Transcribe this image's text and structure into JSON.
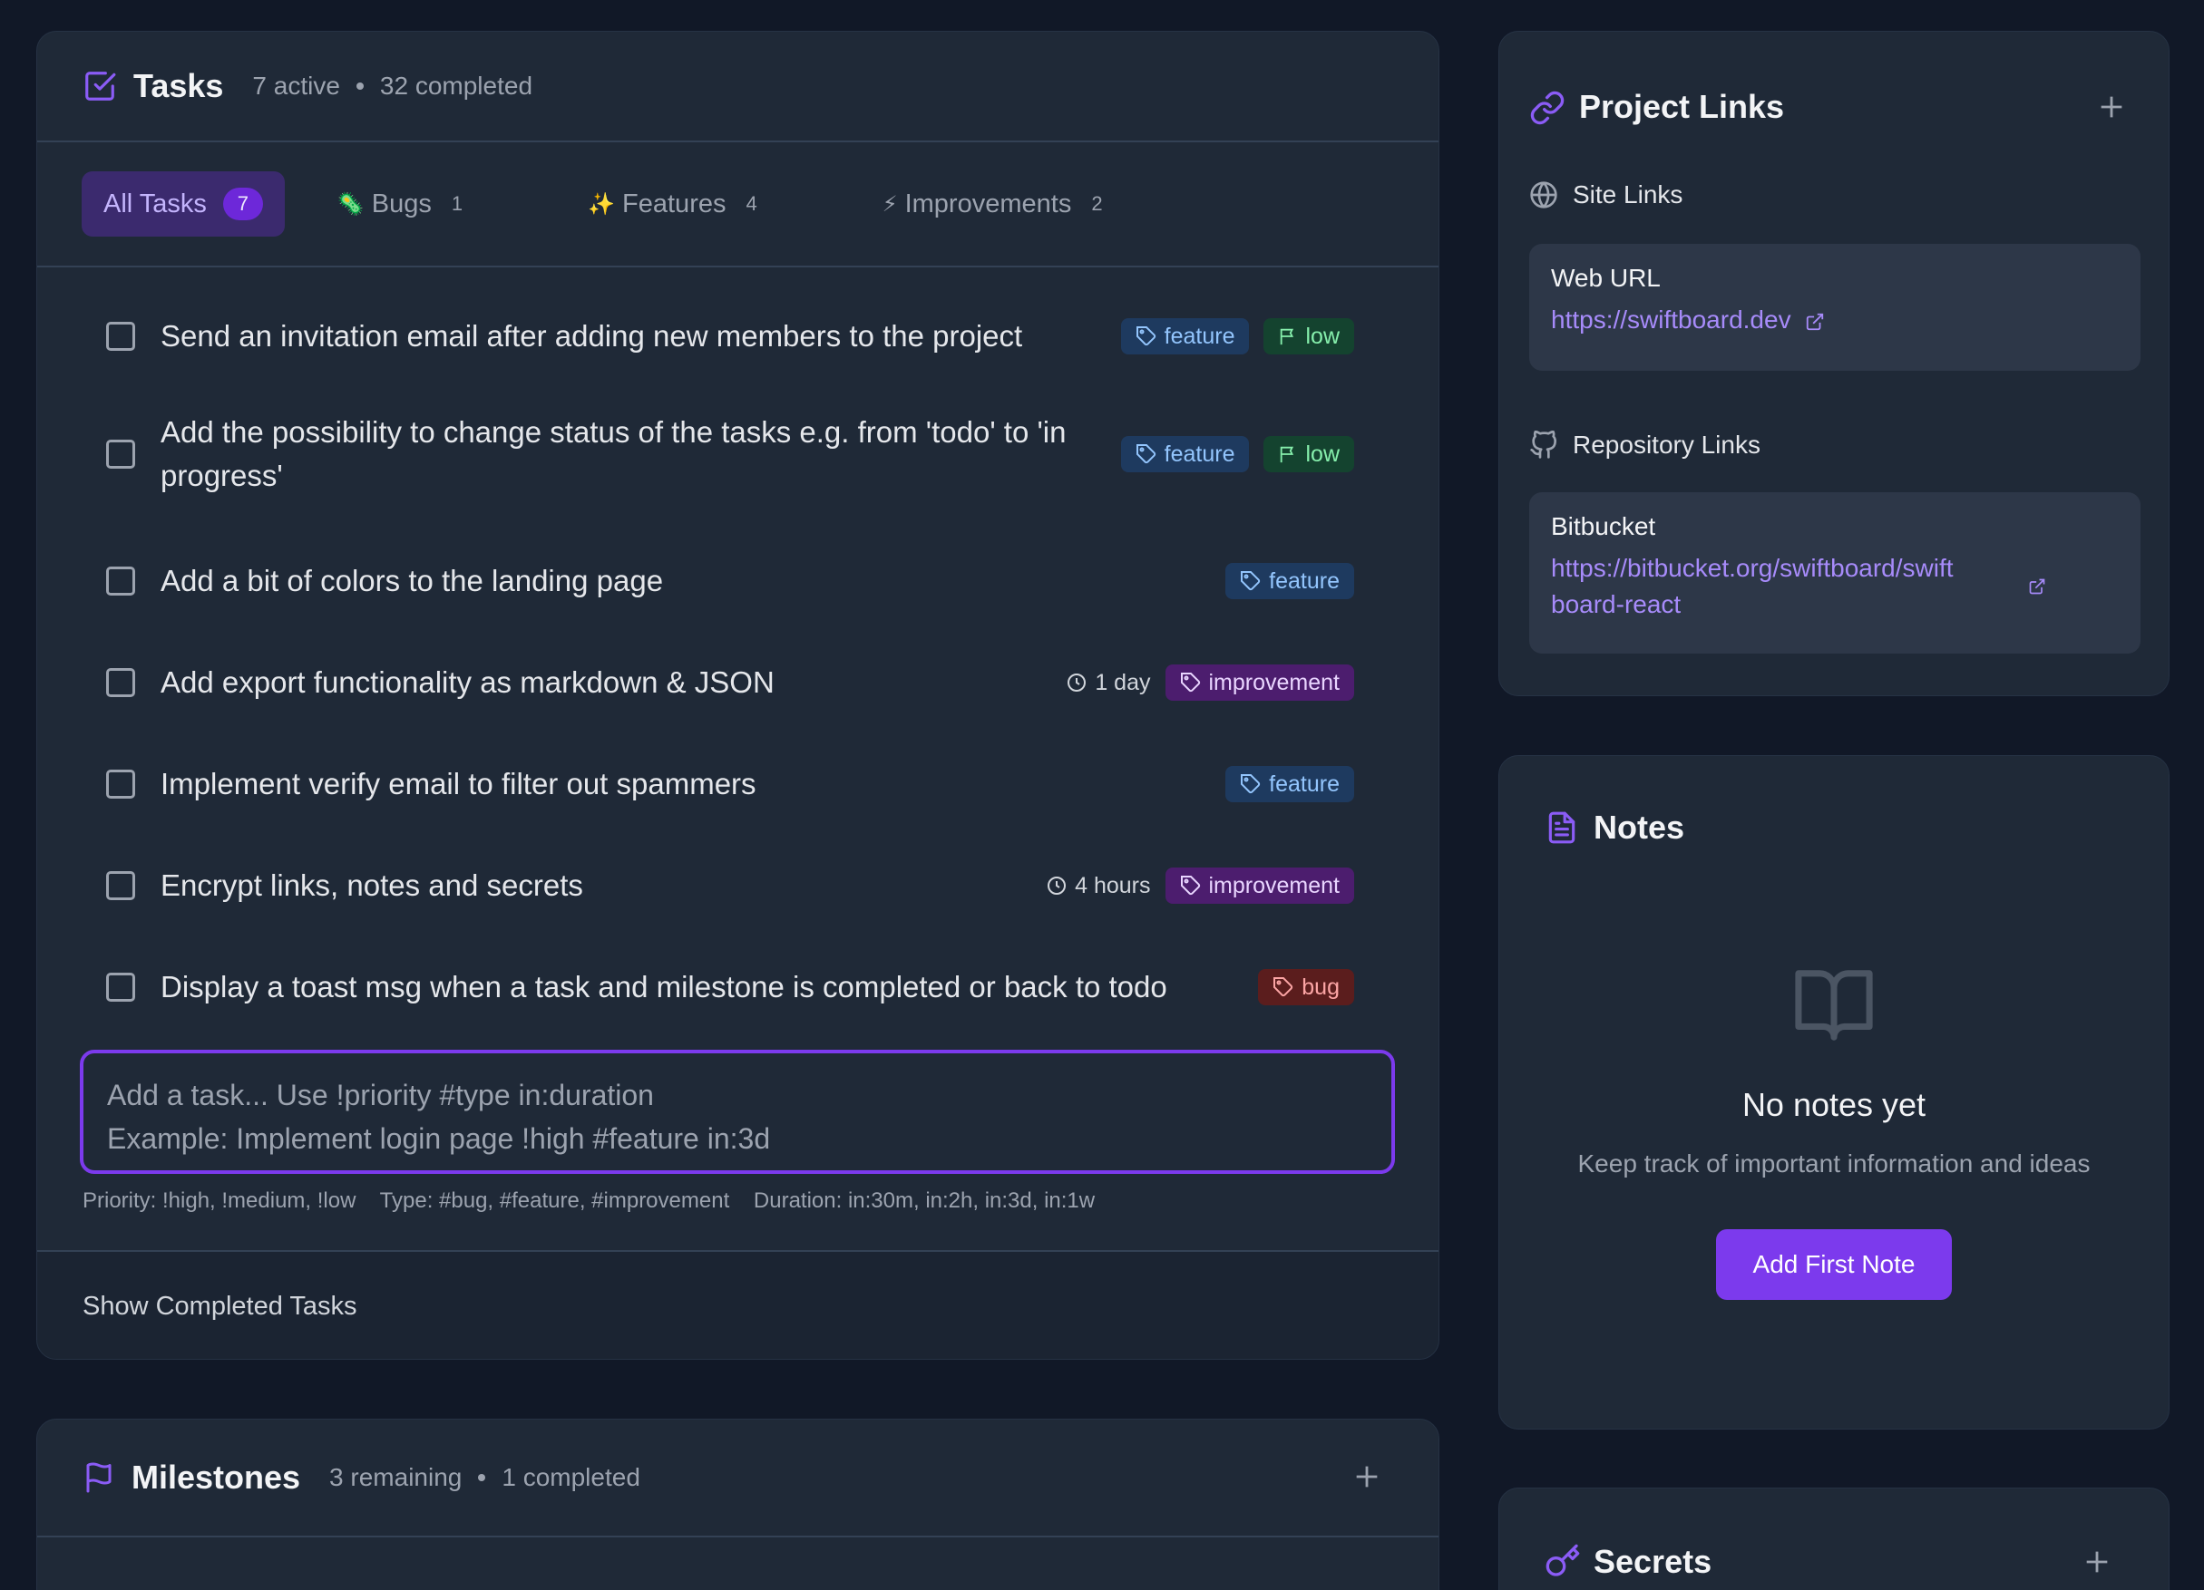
{
  "tasks": {
    "title": "Tasks",
    "active": "7 active",
    "completed": "32 completed",
    "tabs": [
      {
        "label": "All Tasks",
        "count": "7",
        "emoji": ""
      },
      {
        "label": "Bugs",
        "count": "1",
        "emoji": "🦠"
      },
      {
        "label": "Features",
        "count": "4",
        "emoji": "✨"
      },
      {
        "label": "Improvements",
        "count": "2",
        "emoji": "⚡"
      }
    ],
    "items": [
      {
        "text": "Send an invitation email after adding new members to the project",
        "tag": "feature",
        "priority": "low",
        "duration": ""
      },
      {
        "text": "Add the possibility to change status of the tasks e.g. from 'todo' to 'in progress'",
        "tag": "feature",
        "priority": "low",
        "duration": ""
      },
      {
        "text": "Add a bit of colors to the landing page",
        "tag": "feature",
        "priority": "",
        "duration": ""
      },
      {
        "text": "Add export functionality as markdown & JSON",
        "tag": "improvement",
        "priority": "",
        "duration": "1 day"
      },
      {
        "text": "Implement verify email to filter out spammers",
        "tag": "feature",
        "priority": "",
        "duration": ""
      },
      {
        "text": "Encrypt links, notes and secrets",
        "tag": "improvement",
        "priority": "",
        "duration": "4 hours"
      },
      {
        "text": "Display a toast msg when a task and milestone is completed or back to todo",
        "tag": "bug",
        "priority": "",
        "duration": ""
      }
    ],
    "input_placeholder_line1": "Add a task... Use !priority #type in:duration",
    "input_placeholder_line2": "Example: Implement login page !high #feature in:3d",
    "hint_priority": "Priority: !high, !medium, !low",
    "hint_type": "Type: #bug, #feature, #improvement",
    "hint_duration": "Duration: in:30m, in:2h, in:3d, in:1w",
    "show_completed": "Show Completed Tasks"
  },
  "milestones": {
    "title": "Milestones",
    "remaining": "3 remaining",
    "completed": "1 completed"
  },
  "project_links": {
    "title": "Project Links",
    "site_label": "Site Links",
    "site_name": "Web URL",
    "site_url": "https://swiftboard.dev",
    "repo_label": "Repository Links",
    "repo_name": "Bitbucket",
    "repo_url_line1": "https://bitbucket.org/swiftboard/swift",
    "repo_url_line2": "board-react"
  },
  "notes": {
    "title": "Notes",
    "empty_title": "No notes yet",
    "empty_subtitle": "Keep track of important information and ideas",
    "add_button": "Add First Note"
  },
  "secrets": {
    "title": "Secrets"
  },
  "colors": {
    "background": "#111827",
    "card": "#1f2937",
    "accent": "#7c3aed",
    "link": "#a78bfa"
  }
}
